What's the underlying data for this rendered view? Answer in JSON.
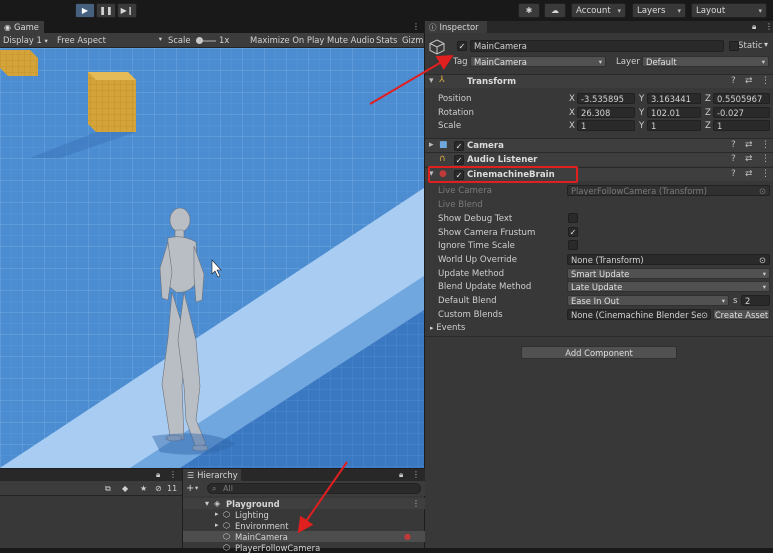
{
  "toolbar": {
    "play_icon": "play-icon",
    "pause_icon": "pause-icon",
    "step_icon": "step-icon",
    "account_label": "Account",
    "layers_label": "Layers",
    "layout_label": "Layout"
  },
  "game": {
    "tab_label": "Game",
    "display_value": "Display 1",
    "aspect_value": "Free Aspect",
    "scale_label": "Scale",
    "scale_value": "1x",
    "maximize_label": "Maximize On Play",
    "mute_label": "Mute Audio",
    "stats_label": "Stats",
    "gizmos_label": "Gizm"
  },
  "inspector": {
    "tab_label": "Inspector",
    "object_name": "MainCamera",
    "static_label": "Static",
    "tag_label": "Tag",
    "tag_value": "MainCamera",
    "layer_label": "Layer",
    "layer_value": "Default",
    "transform": {
      "title": "Transform",
      "position_label": "Position",
      "rotation_label": "Rotation",
      "scale_label": "Scale",
      "position": {
        "x": "-3.535895",
        "y": "3.163441",
        "z": "0.5505967"
      },
      "rotation": {
        "x": "26.308",
        "y": "102.01",
        "z": "-0.027"
      },
      "scale": {
        "x": "1",
        "y": "1",
        "z": "1"
      },
      "axis_x": "X",
      "axis_y": "Y",
      "axis_z": "Z"
    },
    "camera_title": "Camera",
    "audio_title": "Audio Listener",
    "brain": {
      "title": "CinemachineBrain",
      "live_camera_label": "Live Camera",
      "live_camera_value": "PlayerFollowCamera (Transform)",
      "live_blend_label": "Live Blend",
      "show_debug_label": "Show Debug Text",
      "show_frustum_label": "Show Camera Frustum",
      "ignore_time_label": "Ignore Time Scale",
      "world_up_label": "World Up Override",
      "world_up_value": "None (Transform)",
      "update_method_label": "Update Method",
      "update_method_value": "Smart Update",
      "blend_update_label": "Blend Update Method",
      "blend_update_value": "Late Update",
      "default_blend_label": "Default Blend",
      "default_blend_value": "Ease In Out",
      "default_blend_s_label": "s",
      "default_blend_time": "2",
      "custom_blends_label": "Custom Blends",
      "custom_blends_value": "None (Cinemachine Blender Sett",
      "create_asset_label": "Create Asset",
      "events_label": "Events"
    },
    "add_component_label": "Add Component"
  },
  "hierarchy": {
    "tab_label": "Hierarchy",
    "search_placeholder": "All",
    "scene_name": "Playground",
    "items": [
      "Lighting",
      "Environment",
      "MainCamera",
      "PlayerFollowCamera"
    ]
  },
  "project": {
    "hidden_count": "11"
  },
  "colors": {
    "highlight_red": "#e01f1f",
    "selected_blue": "#2c5d87",
    "panel_bg": "#383838"
  }
}
